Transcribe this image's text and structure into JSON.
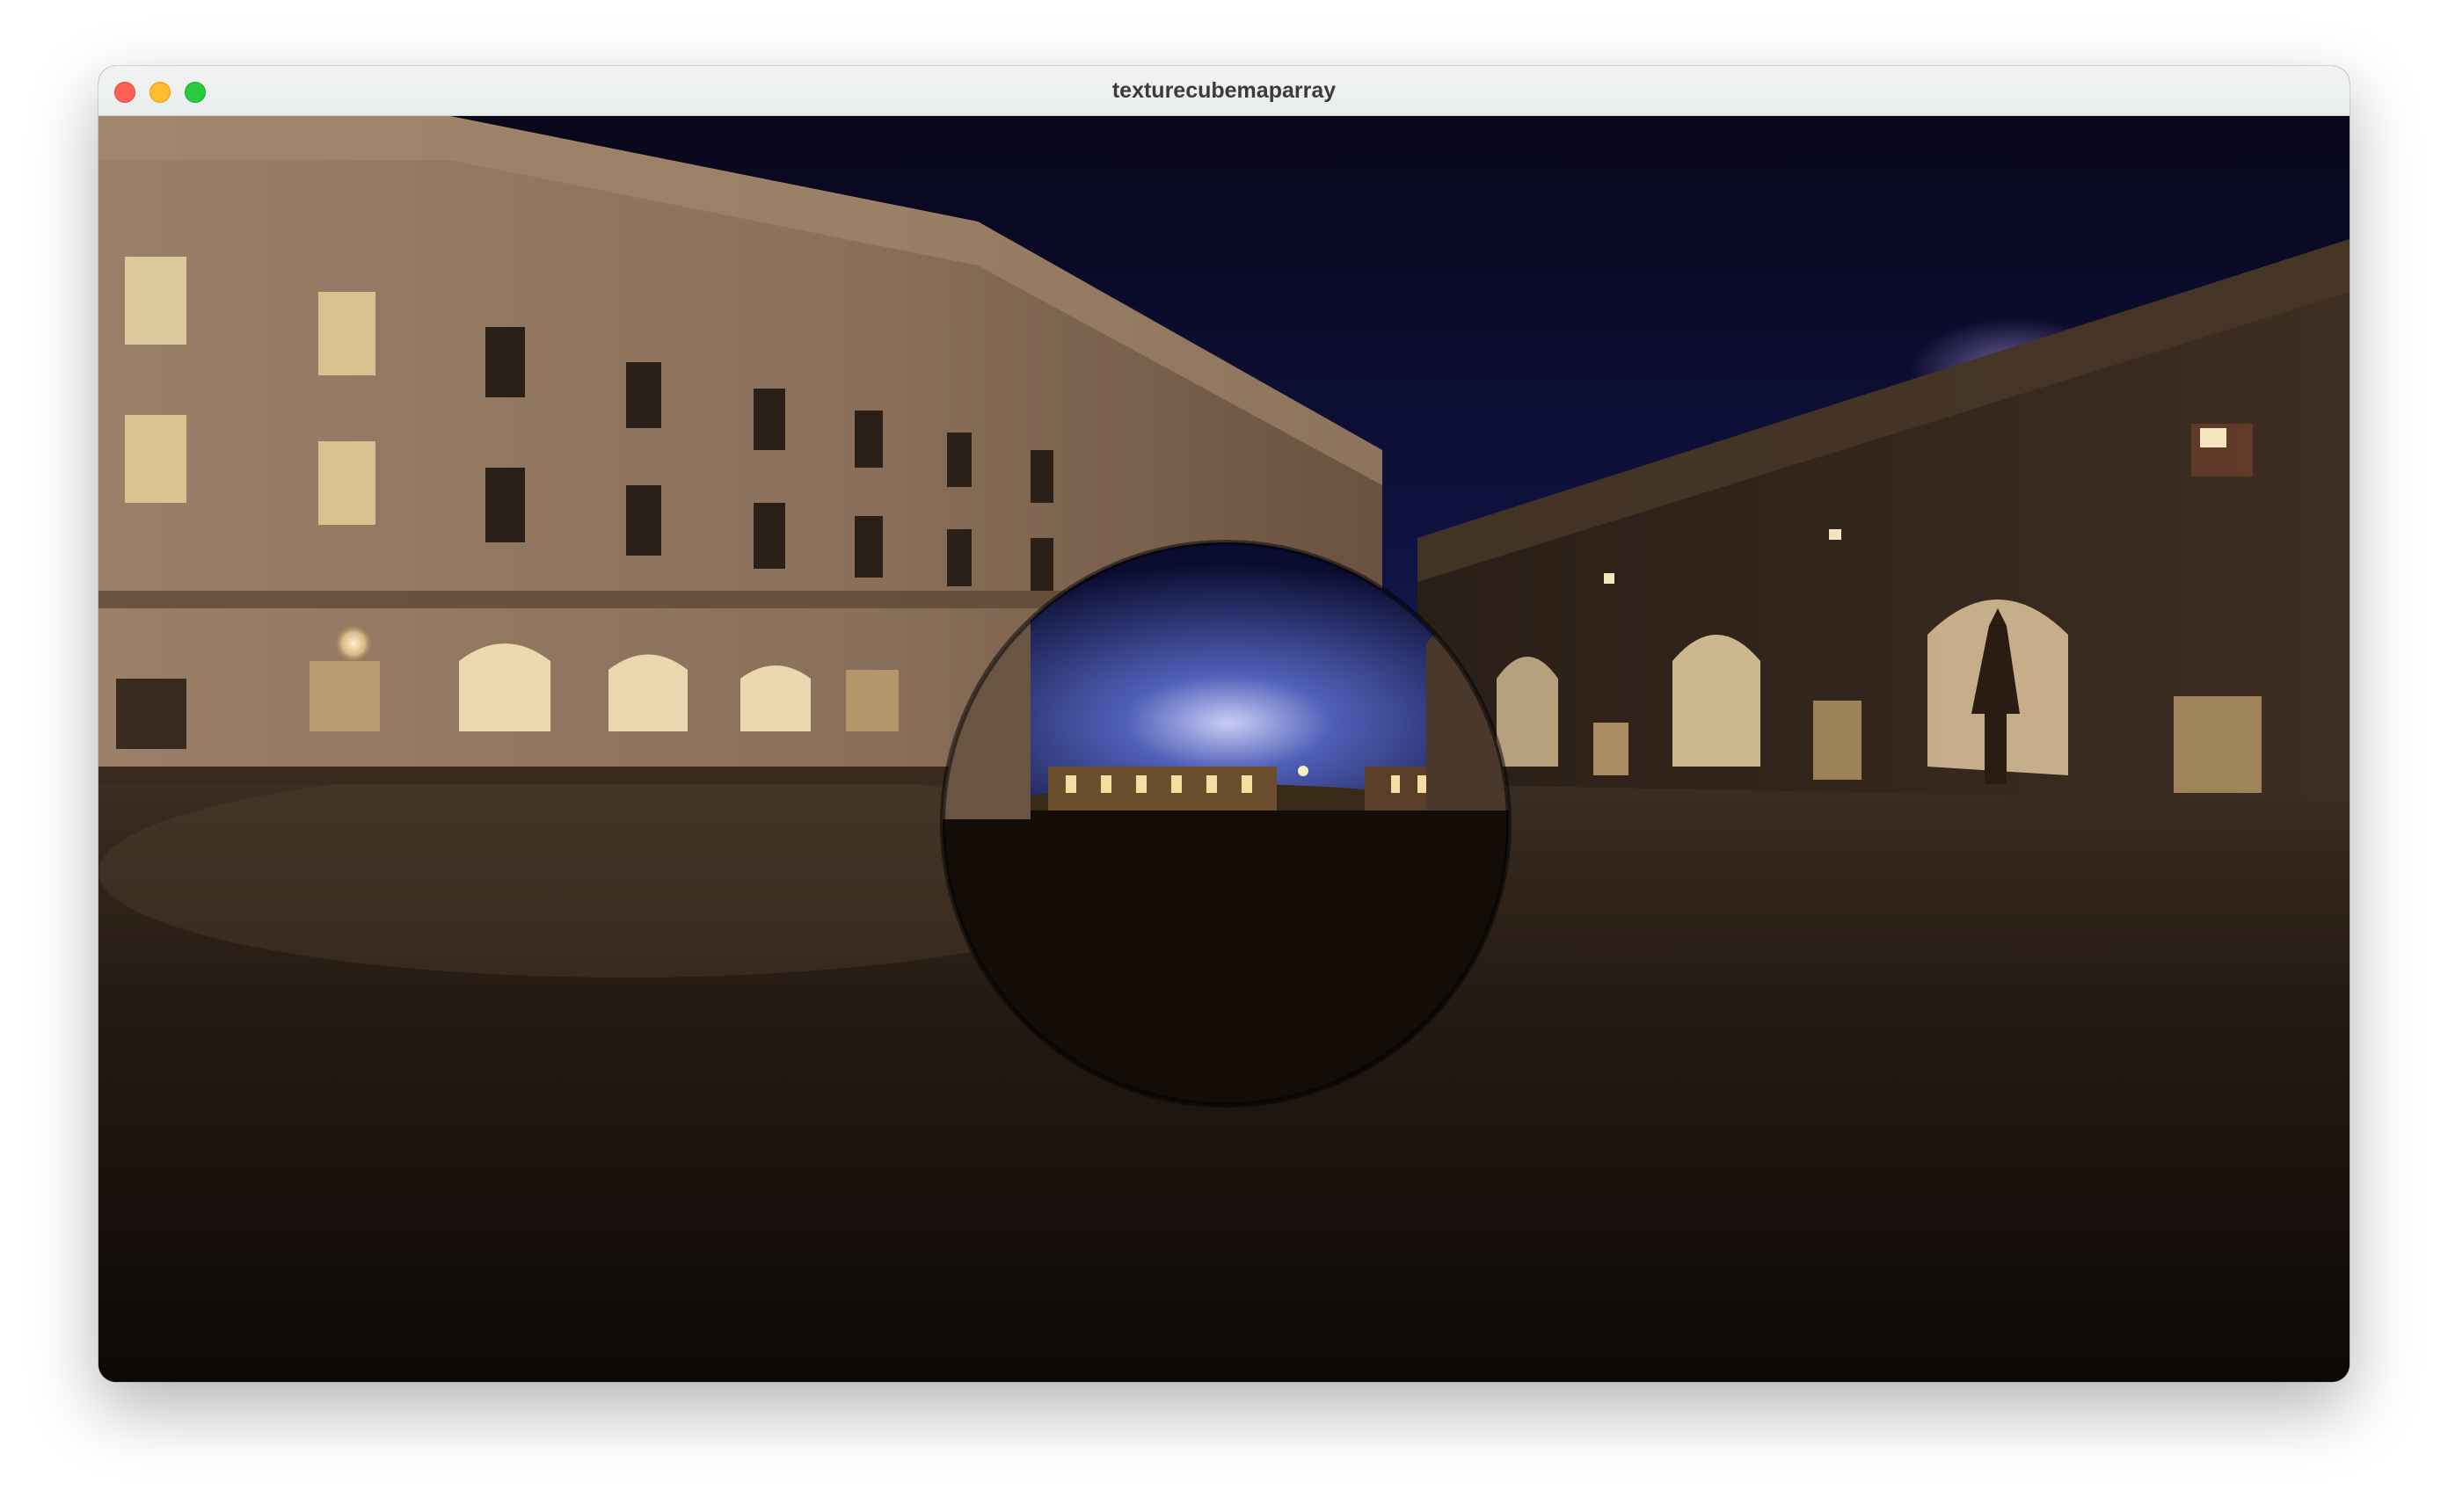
{
  "window": {
    "title": "texturecubemaparray"
  },
  "scene": {
    "description_icon": "reflective-sphere",
    "sky_color": "#0a0b2a",
    "ground_color": "#1a120c",
    "facade_color": "#8a6f58"
  }
}
